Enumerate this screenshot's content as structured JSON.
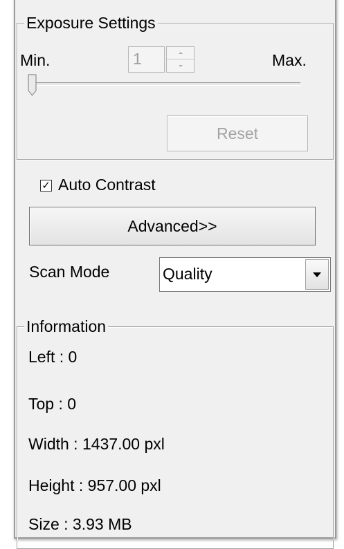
{
  "exposure": {
    "title": "Exposure Settings",
    "min_label": "Min.",
    "max_label": "Max.",
    "value": "1",
    "reset_label": "Reset"
  },
  "auto_contrast": {
    "label": "Auto Contrast",
    "checked": true,
    "mark": "✓"
  },
  "advanced": {
    "label": "Advanced>>"
  },
  "scan_mode": {
    "label": "Scan Mode",
    "value": "Quality"
  },
  "information": {
    "title": "Information",
    "left": "Left : 0",
    "top": "Top : 0",
    "width": "Width : 1437.00 pxl",
    "height": "Height : 957.00 pxl",
    "size": "Size : 3.93 MB"
  }
}
